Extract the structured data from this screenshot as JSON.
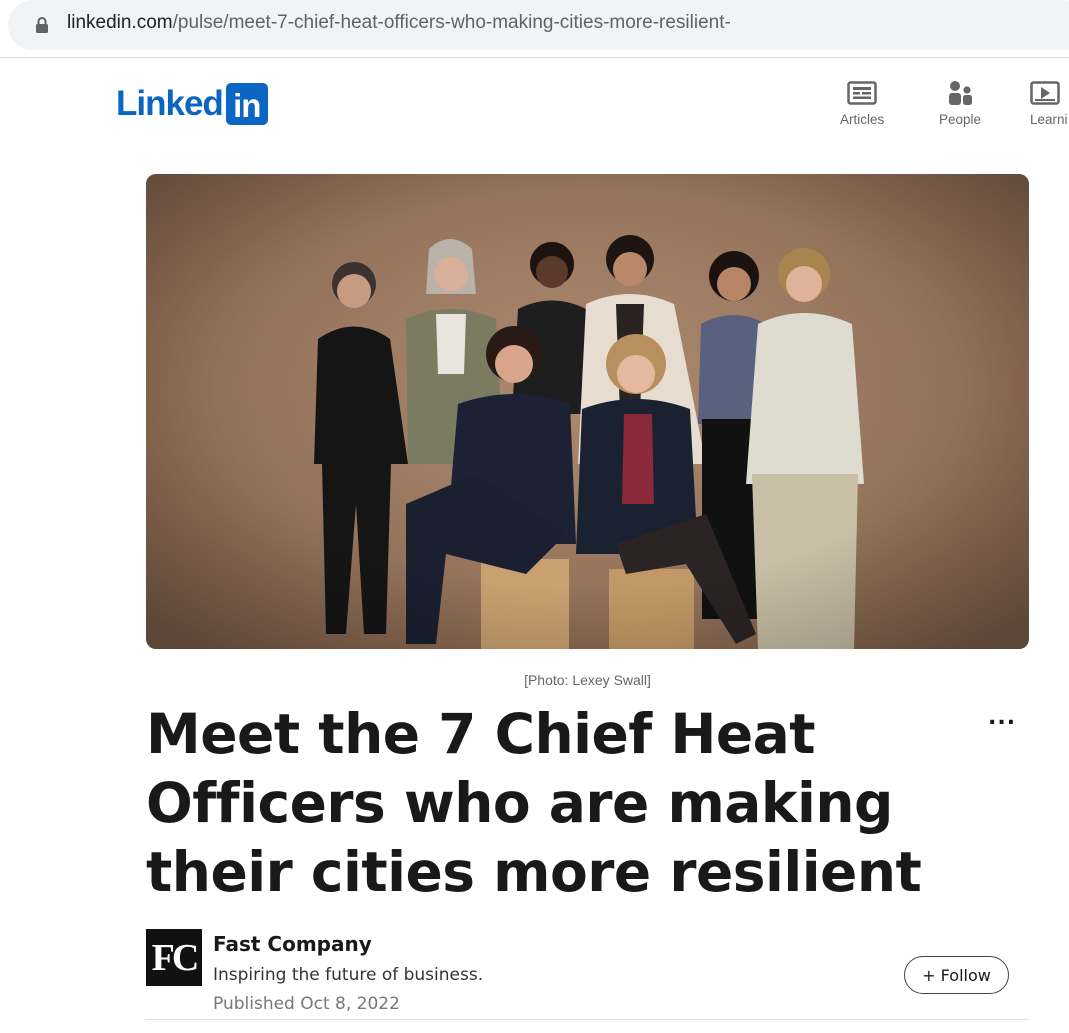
{
  "browser": {
    "url_host": "linkedin.com",
    "url_path": "/pulse/meet-7-chief-heat-officers-who-making-cities-more-resilient-"
  },
  "header": {
    "logo_text": "Linked",
    "logo_badge": "in",
    "nav": [
      {
        "label": "Articles",
        "icon": "articles-icon"
      },
      {
        "label": "People",
        "icon": "people-icon"
      },
      {
        "label": "Learni",
        "icon": "learning-icon"
      }
    ]
  },
  "article": {
    "photo_caption": "[Photo: Lexey Swall]",
    "title": "Meet the 7 Chief Heat Officers who are making their cities more resilient",
    "more_label": "..."
  },
  "author": {
    "logo_text": "FC",
    "name": "Fast Company",
    "tagline": "Inspiring the future of business.",
    "published": "Published Oct 8, 2022",
    "follow_label": "+ Follow"
  },
  "colors": {
    "brand": "#0a66c2",
    "hero_backdrop": "#9a7860"
  }
}
